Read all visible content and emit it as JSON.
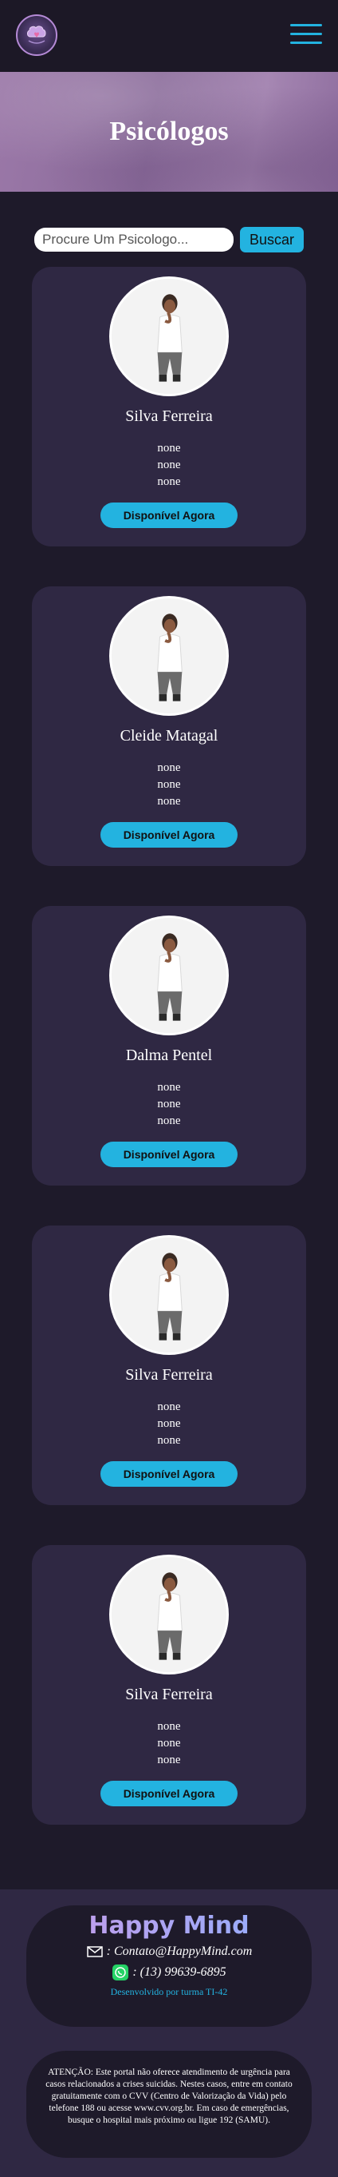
{
  "brand": {
    "logo_icon": "brain-heart-logo",
    "name": "Happy Mind"
  },
  "nav": {
    "menu_icon": "hamburger-menu-icon"
  },
  "hero": {
    "title": "Psicólogos"
  },
  "search": {
    "placeholder": "Procure Um Psicologo...",
    "button_label": "Buscar"
  },
  "psychologists": [
    {
      "name": "Silva Ferreira",
      "info": [
        "none",
        "none",
        "none"
      ],
      "status": "Disponível Agora"
    },
    {
      "name": "Cleide Matagal",
      "info": [
        "none",
        "none",
        "none"
      ],
      "status": "Disponível Agora"
    },
    {
      "name": "Dalma Pentel",
      "info": [
        "none",
        "none",
        "none"
      ],
      "status": "Disponível Agora"
    },
    {
      "name": "Silva Ferreira",
      "info": [
        "none",
        "none",
        "none"
      ],
      "status": "Disponível Agora"
    },
    {
      "name": "Silva Ferreira",
      "info": [
        "none",
        "none",
        "none"
      ],
      "status": "Disponível Agora"
    }
  ],
  "footer": {
    "brand": "Happy Mind",
    "email": ": Contato@HappyMind.com",
    "phone": ": (13) 99639-6895",
    "credit": "Desenvolvido por turma TI-42",
    "warning": "ATENÇÃO: Este portal não oferece atendimento de urgência para casos relacionados a crises suicidas. Nestes casos, entre em contato gratuitamente com o CVV (Centro de Valorização da Vida) pelo telefone 188 ou acesse www.cvv.org.br. Em caso de emergências, busque o hospital mais próximo ou ligue 192 (SAMU)."
  },
  "colors": {
    "accent": "#23b3e0",
    "card": "#2f2843",
    "background": "#1e1a2a",
    "hero": "#9b78a8"
  }
}
